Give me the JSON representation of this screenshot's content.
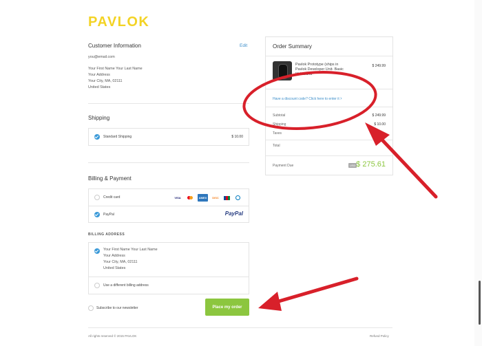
{
  "brand": {
    "logo": "PAVLOK",
    "accent": "#f3d325"
  },
  "customer": {
    "title": "Customer Information",
    "edit": "Edit",
    "email": "you@email.com",
    "address_lines": [
      "Your First Name Your Last Name",
      "Your Address",
      "Your City, MA, 02111",
      "United States"
    ]
  },
  "shipping": {
    "title": "Shipping",
    "option_label": "Standard Shipping",
    "option_price": "$ 10.00",
    "selected": true
  },
  "billing": {
    "title": "Billing & Payment",
    "credit_card_label": "Credit card",
    "card_brands": [
      "VISA",
      "MC",
      "AMEX",
      "DISC",
      "JCB",
      "DC"
    ],
    "paypal_label": "PayPal",
    "paypal_logo": "PayPal",
    "selected": "PayPal"
  },
  "billing_address": {
    "heading": "BILLING ADDRESS",
    "same_lines": [
      "Your First Name Your Last Name",
      "Your Address",
      "Your City, MA, 02111",
      "United States"
    ],
    "different_label": "Use a different billing address"
  },
  "newsletter_label": "Subscribe to our newsletter",
  "place_order_label": "Place my order",
  "footer": {
    "left": "All rights reserved © 2015 PAVLOK",
    "right": "Refund Policy"
  },
  "order_summary": {
    "title": "Order Summary",
    "product_name_line1": "Pavlok Prototype (ships in",
    "product_name_line2": "Pavlok Developer Unit- Basic",
    "product_name_line3": "Wristband",
    "product_price": "$ 249.99",
    "discount_link": "Have a discount code? Click here to enter it",
    "subtotal_label": "Subtotal",
    "subtotal_value": "$ 249.99",
    "shipping_label": "Shipping",
    "shipping_value": "$ 10.00",
    "taxes_label": "Taxes",
    "taxes_value": "",
    "total_label": "Total",
    "total_value": "",
    "payment_due_label": "Payment Due",
    "currency_badge": "USD",
    "payment_due_value": "$ 275.61"
  },
  "annotations": {
    "color": "#d8202a"
  }
}
